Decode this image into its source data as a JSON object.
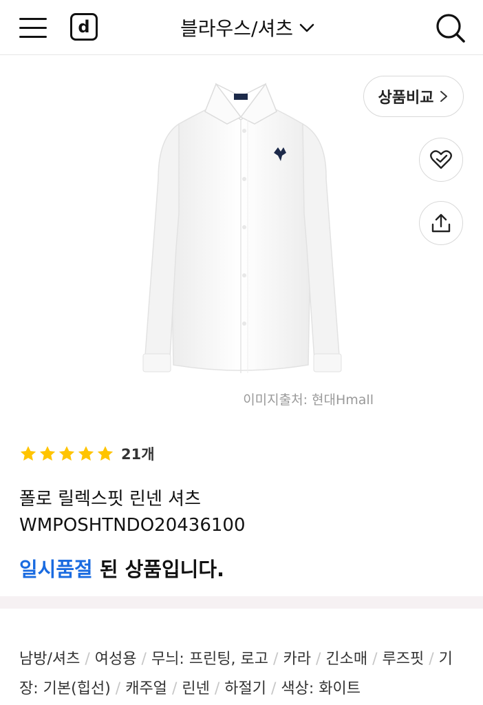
{
  "header": {
    "menu_icon": "hamburger-menu-icon",
    "logo_text": "d",
    "category_title": "블라우스/셔츠",
    "dropdown_icon": "chevron-down-icon",
    "search_icon": "search-icon"
  },
  "product": {
    "compare_label": "상품비교",
    "compare_icon": "chevron-right-icon",
    "wish_icon": "heart-check-icon",
    "share_icon": "share-upload-icon",
    "image_credit": "이미지출처: 현대Hmall",
    "rating": {
      "stars": 5,
      "max": 5,
      "star_color": "#FFC400",
      "review_count": "21개"
    },
    "name": "폴로 릴렉스핏 린넨 셔츠",
    "code": "WMPOSHTNDO20436100",
    "soldout_accent": "일시품절",
    "soldout_rest": " 된 상품입니다.",
    "accent_color": "#1A6BE0"
  },
  "tags": [
    "남방/셔츠",
    "여성용",
    "무늬: 프린팅, 로고",
    "카라",
    "긴소매",
    "루즈핏",
    "기장: 기본(힙선)",
    "캐주얼",
    "린넨",
    "하절기",
    "색상: 화이트"
  ]
}
